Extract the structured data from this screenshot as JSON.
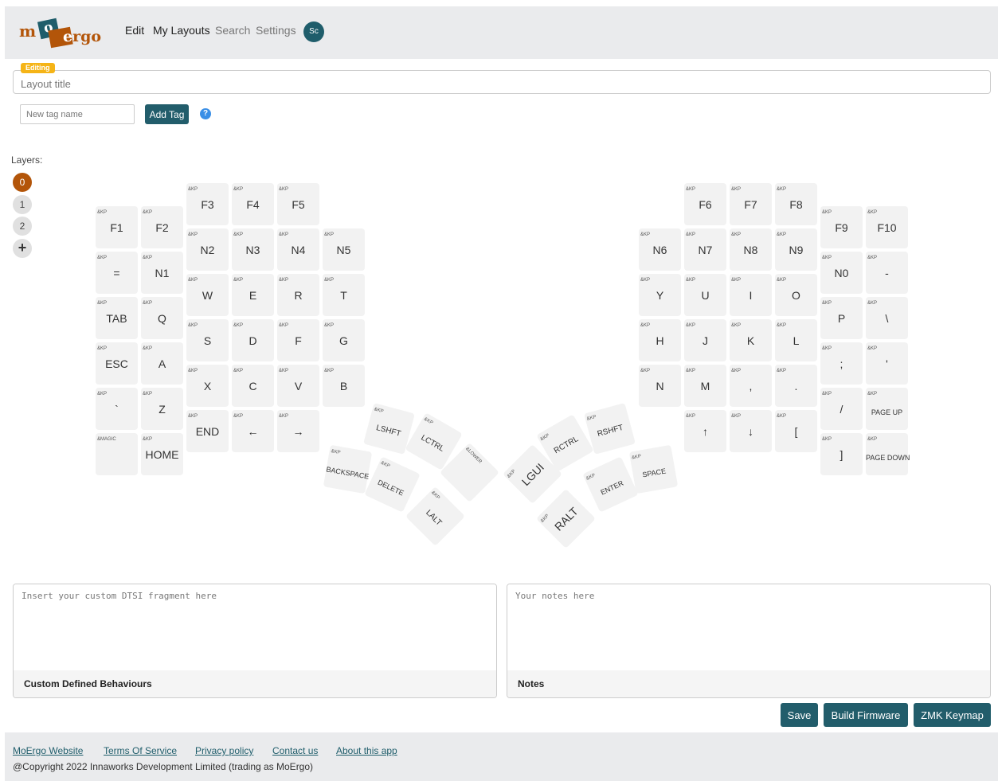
{
  "nav": {
    "logo": {
      "m": "m",
      "o": "o",
      "e": "e",
      "rgo": "rgo"
    },
    "links": [
      "Edit",
      "My Layouts",
      "Search",
      "Settings"
    ],
    "avatar": "Sc"
  },
  "editor": {
    "badge": "Editing",
    "title_placeholder": "Layout title",
    "tag_placeholder": "New tag name",
    "add_tag": "Add Tag",
    "help": "?"
  },
  "layers": {
    "label": "Layers:",
    "items": [
      "0",
      "1",
      "2"
    ],
    "add": "+"
  },
  "keys": {
    "f1": {
      "b": "&KP",
      "l": "F1"
    },
    "f2": {
      "b": "&KP",
      "l": "F2"
    },
    "f3": {
      "b": "&KP",
      "l": "F3"
    },
    "f4": {
      "b": "&KP",
      "l": "F4"
    },
    "f5": {
      "b": "&KP",
      "l": "F5"
    },
    "eq": {
      "b": "&KP",
      "l": "="
    },
    "n1": {
      "b": "&KP",
      "l": "N1"
    },
    "n2": {
      "b": "&KP",
      "l": "N2"
    },
    "n3": {
      "b": "&KP",
      "l": "N3"
    },
    "n4": {
      "b": "&KP",
      "l": "N4"
    },
    "n5": {
      "b": "&KP",
      "l": "N5"
    },
    "tab": {
      "b": "&KP",
      "l": "TAB"
    },
    "q": {
      "b": "&KP",
      "l": "Q"
    },
    "w": {
      "b": "&KP",
      "l": "W"
    },
    "e": {
      "b": "&KP",
      "l": "E"
    },
    "r": {
      "b": "&KP",
      "l": "R"
    },
    "t": {
      "b": "&KP",
      "l": "T"
    },
    "esc": {
      "b": "&KP",
      "l": "ESC"
    },
    "a": {
      "b": "&KP",
      "l": "A"
    },
    "s": {
      "b": "&KP",
      "l": "S"
    },
    "d": {
      "b": "&KP",
      "l": "D"
    },
    "f": {
      "b": "&KP",
      "l": "F"
    },
    "g": {
      "b": "&KP",
      "l": "G"
    },
    "grave": {
      "b": "&KP",
      "l": "`"
    },
    "z": {
      "b": "&KP",
      "l": "Z"
    },
    "x": {
      "b": "&KP",
      "l": "X"
    },
    "c": {
      "b": "&KP",
      "l": "C"
    },
    "v": {
      "b": "&KP",
      "l": "V"
    },
    "bk": {
      "b": "&KP",
      "l": "B"
    },
    "magic": {
      "b": "&MAGIC",
      "l": ""
    },
    "home": {
      "b": "&KP",
      "l": "HOME"
    },
    "end": {
      "b": "&KP",
      "l": "END"
    },
    "left": {
      "b": "&KP",
      "l": "←"
    },
    "right": {
      "b": "&KP",
      "l": "→"
    },
    "lshft": {
      "b": "&KP",
      "l": "LSHFT"
    },
    "lctrl": {
      "b": "&KP",
      "l": "LCTRL"
    },
    "lower": {
      "b": "&LOWER",
      "l": ""
    },
    "bksp": {
      "b": "&KP",
      "l": "BACKSPACE"
    },
    "del": {
      "b": "&KP",
      "l": "DELETE"
    },
    "lalt": {
      "b": "&KP",
      "l": "LALT"
    },
    "f6": {
      "b": "&KP",
      "l": "F6"
    },
    "f7": {
      "b": "&KP",
      "l": "F7"
    },
    "f8": {
      "b": "&KP",
      "l": "F8"
    },
    "f9": {
      "b": "&KP",
      "l": "F9"
    },
    "f10": {
      "b": "&KP",
      "l": "F10"
    },
    "n6": {
      "b": "&KP",
      "l": "N6"
    },
    "n7": {
      "b": "&KP",
      "l": "N7"
    },
    "n8": {
      "b": "&KP",
      "l": "N8"
    },
    "n9": {
      "b": "&KP",
      "l": "N9"
    },
    "n0": {
      "b": "&KP",
      "l": "N0"
    },
    "minus": {
      "b": "&KP",
      "l": "-"
    },
    "y": {
      "b": "&KP",
      "l": "Y"
    },
    "u": {
      "b": "&KP",
      "l": "U"
    },
    "i": {
      "b": "&KP",
      "l": "I"
    },
    "o": {
      "b": "&KP",
      "l": "O"
    },
    "p": {
      "b": "&KP",
      "l": "P"
    },
    "bslh": {
      "b": "&KP",
      "l": "\\"
    },
    "h": {
      "b": "&KP",
      "l": "H"
    },
    "j": {
      "b": "&KP",
      "l": "J"
    },
    "k": {
      "b": "&KP",
      "l": "K"
    },
    "l": {
      "b": "&KP",
      "l": "L"
    },
    "semi": {
      "b": "&KP",
      "l": ";"
    },
    "sqt": {
      "b": "&KP",
      "l": "'"
    },
    "n": {
      "b": "&KP",
      "l": "N"
    },
    "m": {
      "b": "&KP",
      "l": "M"
    },
    "comma": {
      "b": "&KP",
      "l": ","
    },
    "dot": {
      "b": "&KP",
      "l": "."
    },
    "fslh": {
      "b": "&KP",
      "l": "/"
    },
    "pgup": {
      "b": "&KP",
      "l": "PAGE UP"
    },
    "up": {
      "b": "&KP",
      "l": "↑"
    },
    "down": {
      "b": "&KP",
      "l": "↓"
    },
    "lbkt": {
      "b": "&KP",
      "l": "["
    },
    "rbkt": {
      "b": "&KP",
      "l": "]"
    },
    "pgdn": {
      "b": "&KP",
      "l": "PAGE DOWN"
    },
    "rctrl": {
      "b": "&KP",
      "l": "RCTRL"
    },
    "rshft": {
      "b": "&KP",
      "l": "RSHFT"
    },
    "lgui": {
      "b": "&KP",
      "l": "LGUI"
    },
    "enter": {
      "b": "&KP",
      "l": "ENTER"
    },
    "space": {
      "b": "&KP",
      "l": "SPACE"
    },
    "ralt": {
      "b": "&KP",
      "l": "RALT"
    }
  },
  "panels": {
    "dtsi_placeholder": "Insert your custom DTSI fragment here",
    "dtsi_label": "Custom Defined Behaviours",
    "notes_placeholder": "Your notes here",
    "notes_label": "Notes"
  },
  "actions": {
    "save": "Save",
    "build": "Build Firmware",
    "zmk": "ZMK Keymap"
  },
  "footer": {
    "links": [
      "MoErgo Website",
      "Terms Of Service",
      "Privacy policy",
      "Contact us",
      "About this app"
    ],
    "copyright": "@Copyright 2022 Innaworks Development Limited (trading as MoErgo)"
  }
}
